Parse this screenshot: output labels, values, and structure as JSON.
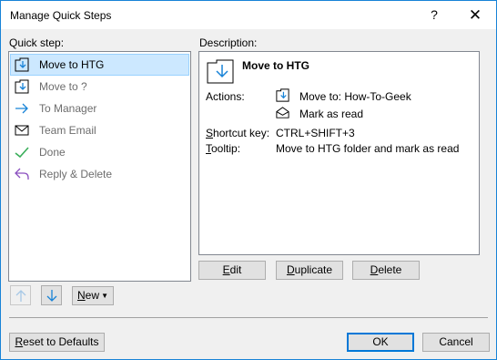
{
  "window": {
    "title": "Manage Quick Steps",
    "help_glyph": "?",
    "close_glyph": "✕"
  },
  "quick_step": {
    "label": "Quick step:",
    "items": [
      {
        "label": "Move to HTG",
        "icon": "move-to-folder-icon",
        "selected": true
      },
      {
        "label": "Move to ?",
        "icon": "move-to-folder-icon",
        "selected": false
      },
      {
        "label": "To Manager",
        "icon": "arrow-right-icon",
        "selected": false
      },
      {
        "label": "Team Email",
        "icon": "envelope-icon",
        "selected": false
      },
      {
        "label": "Done",
        "icon": "checkmark-icon",
        "selected": false
      },
      {
        "label": "Reply & Delete",
        "icon": "reply-icon",
        "selected": false
      }
    ],
    "buttons": {
      "move_up": "up-arrow-icon",
      "move_down": "down-arrow-icon",
      "new_label": "New",
      "new_accel": "N",
      "new_rest": "ew"
    }
  },
  "description": {
    "label": "Description:",
    "name": "Move to HTG",
    "actions_label": "Actions:",
    "actions": [
      {
        "icon": "move-to-folder-icon",
        "text": "Move to: How-To-Geek"
      },
      {
        "icon": "open-envelope-icon",
        "text": "Mark as read"
      }
    ],
    "shortcut_label_accel": "S",
    "shortcut_label_rest": "hortcut key:",
    "shortcut_value": "CTRL+SHIFT+3",
    "tooltip_label_accel": "T",
    "tooltip_label_rest": "ooltip:",
    "tooltip_value": "Move to HTG folder and mark as read"
  },
  "edit_buttons": {
    "edit": {
      "accel": "E",
      "rest": "dit"
    },
    "duplicate": {
      "accel": "D",
      "pre": "",
      "rest": "uplicate"
    },
    "delete": {
      "pre": "",
      "accel": "D",
      "rest": "elete"
    }
  },
  "footer": {
    "reset": {
      "accel": "R",
      "rest": "eset to Defaults"
    },
    "ok": "OK",
    "cancel": "Cancel"
  },
  "colors": {
    "accent": "#1883d7",
    "selection": "#cce8ff",
    "check": "#3aae5a",
    "reply": "#8a4fbf",
    "arrow": "#1883d7"
  }
}
